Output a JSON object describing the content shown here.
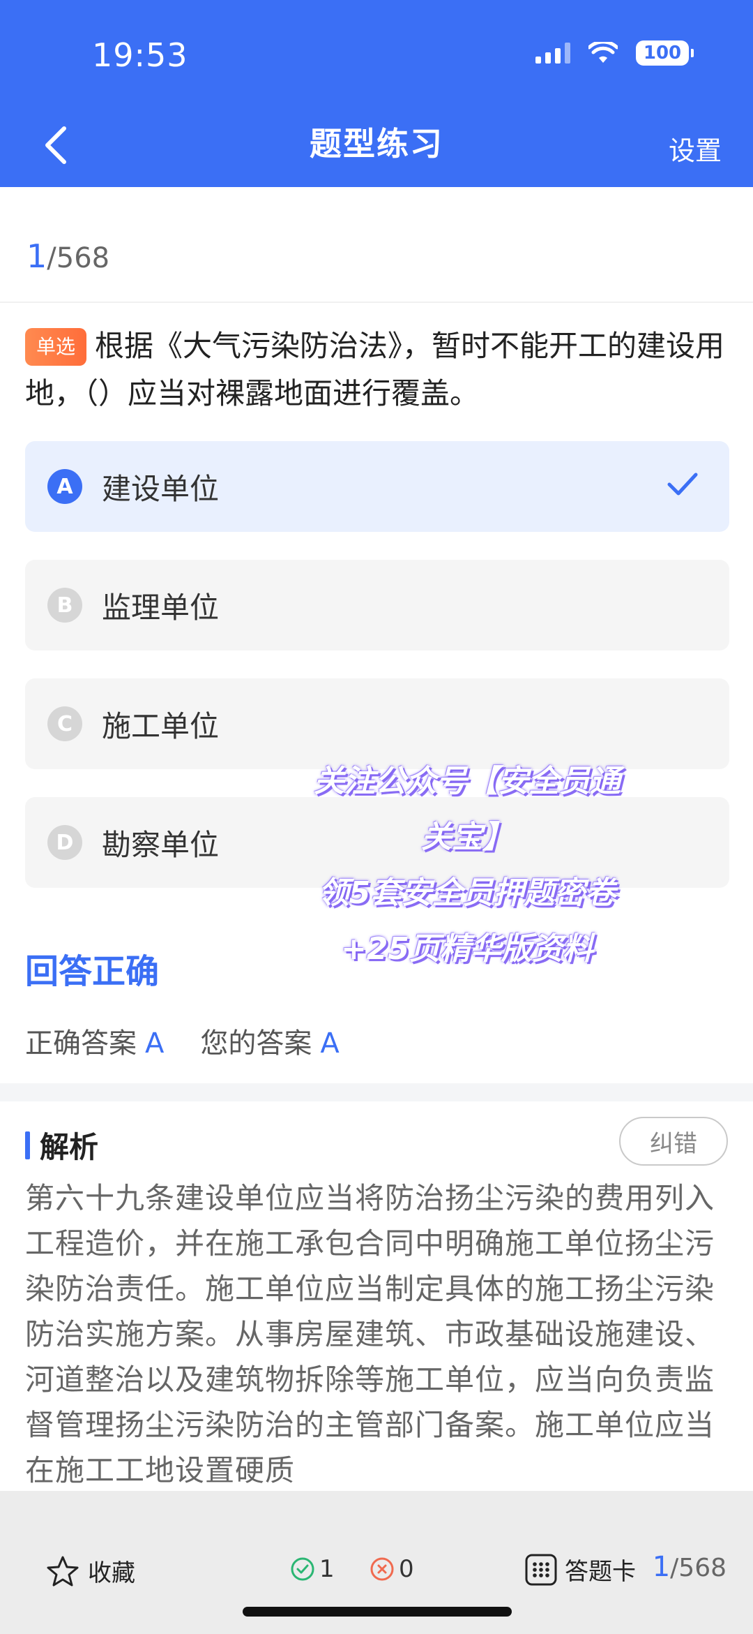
{
  "status": {
    "time": "19:53",
    "battery": "100"
  },
  "nav": {
    "title": "题型练习",
    "settings": "设置"
  },
  "progress": {
    "current": "1",
    "total": "/568"
  },
  "question": {
    "type_badge": "单选",
    "text": "根据《大气污染防治法》，暂时不能开工的建设用地，（）应当对裸露地面进行覆盖。"
  },
  "options": [
    {
      "letter": "A",
      "text": "建设单位",
      "selected": true
    },
    {
      "letter": "B",
      "text": "监理单位",
      "selected": false
    },
    {
      "letter": "C",
      "text": "施工单位",
      "selected": false
    },
    {
      "letter": "D",
      "text": "勘察单位",
      "selected": false
    }
  ],
  "result": {
    "title": "回答正确",
    "correct_label": "正确答案",
    "correct_value": "A",
    "your_label": "您的答案",
    "your_value": "A"
  },
  "analysis": {
    "label": "解析",
    "report_button": "纠错",
    "text": "第六十九条建设单位应当将防治扬尘污染的费用列入工程造价，并在施工承包合同中明确施工单位扬尘污染防治责任。施工单位应当制定具体的施工扬尘污染防治实施方案。从事房屋建筑、市政基础设施建设、河道整治以及建筑物拆除等施工单位，应当向负责监督管理扬尘污染防治的主管部门备案。施工单位应当在施工工地设置硬质"
  },
  "watermark": {
    "line1": "关注公众号【安全员通",
    "line2": "关宝】",
    "line3": "领5套安全员押题密卷",
    "line4": "+25页精华版资料"
  },
  "bottom": {
    "favorite": "收藏",
    "correct_count": "1",
    "wrong_count": "0",
    "answer_card": "答题卡",
    "current": "1",
    "total": "/568"
  },
  "colors": {
    "accent": "#3b6ff5",
    "badge": "#ff6d3a",
    "correct": "#2bb673",
    "wrong": "#f06a4f"
  }
}
